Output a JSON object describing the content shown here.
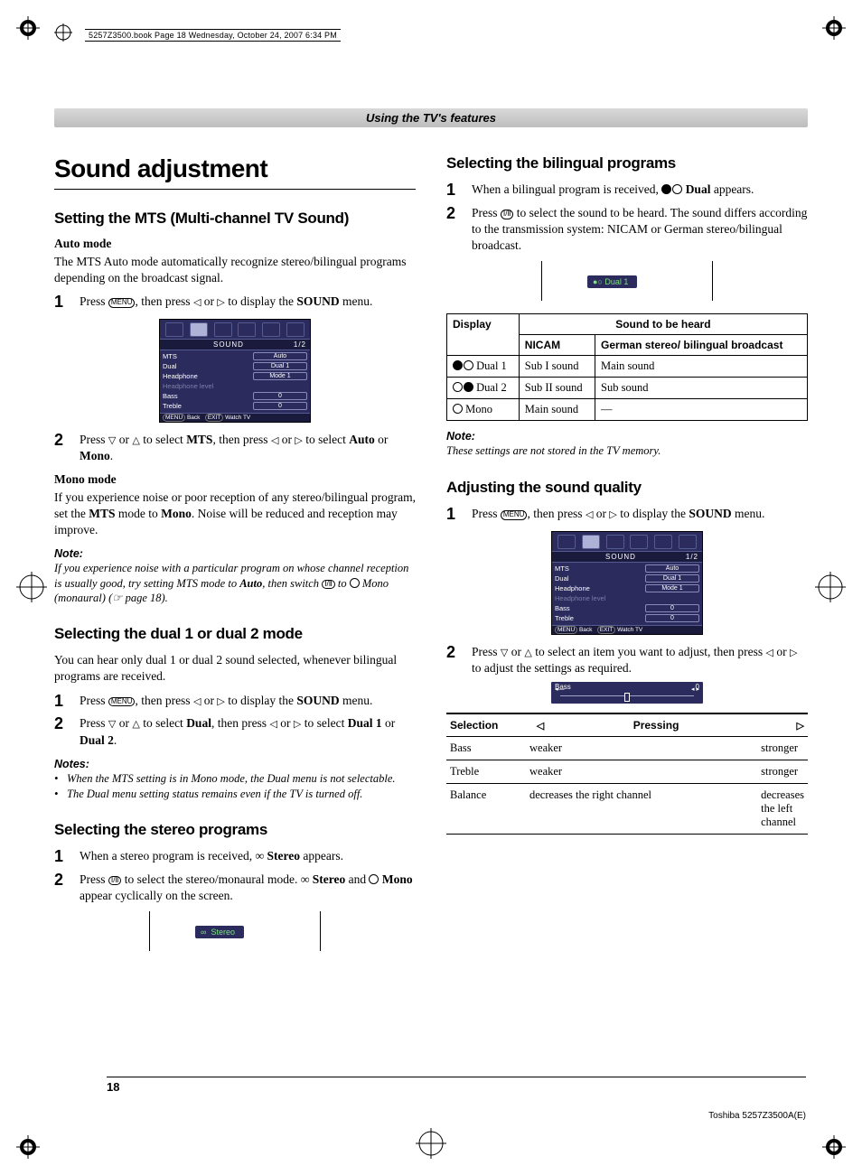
{
  "header_line": "5257Z3500.book  Page 18  Wednesday, October 24, 2007  6:34 PM",
  "section_bar": "Using the TV's features",
  "main_title": "Sound adjustment",
  "mts": {
    "heading": "Setting the MTS (Multi-channel TV Sound)",
    "auto_head": "Auto mode",
    "auto_body": "The MTS Auto mode automatically recognize stereo/bilingual programs depending on the broadcast signal.",
    "step1_a": "Press ",
    "step1_menu": "MENU",
    "step1_b": ", then press ",
    "step1_c": " or ",
    "step1_d": " to display the ",
    "step1_bold": "SOUND",
    "step1_e": " menu.",
    "step2_a": "Press ",
    "step2_b": " or ",
    "step2_c": " to select ",
    "step2_mts": "MTS",
    "step2_d": ", then press ",
    "step2_e": " or ",
    "step2_f": " to select ",
    "step2_auto": "Auto",
    "step2_g": " or ",
    "step2_mono": "Mono",
    "step2_h": ".",
    "mono_head": "Mono mode",
    "mono_body_a": "If you experience noise or poor reception of any stereo/bilingual program, set the ",
    "mono_body_mts": "MTS",
    "mono_body_b": " mode to ",
    "mono_body_mono": "Mono",
    "mono_body_c": ". Noise will be reduced and reception may improve.",
    "note_head": "Note:",
    "note_body_a": "If you experience noise with a particular program on whose channel reception is usually good, try setting MTS mode to ",
    "note_auto": "Auto",
    "note_body_b": ", then switch ",
    "note_btn": "Ⅰ/Ⅱ",
    "note_body_c": " to ",
    "note_body_d": " Mono (monaural) (",
    "note_page": " page 18)."
  },
  "dual": {
    "heading": "Selecting the dual 1 or dual 2 mode",
    "intro": "You can hear only dual 1 or dual 2 sound selected, whenever bilingual programs are received.",
    "step1_a": "Press ",
    "step1_b": ", then press ",
    "step1_c": " or ",
    "step1_d": " to display the ",
    "step1_bold": "SOUND",
    "step1_e": " menu.",
    "step2_a": "Press ",
    "step2_b": " or ",
    "step2_c": " to select ",
    "step2_dual": "Dual",
    "step2_d": ", then press ",
    "step2_e": " or ",
    "step2_f": " to select ",
    "step2_d1": "Dual 1",
    "step2_g": " or ",
    "step2_d2": "Dual 2",
    "step2_h": ".",
    "notes_head": "Notes:",
    "note1_a": "When the MTS setting is in ",
    "note1_mono": "Mono",
    "note1_b": " mode, the ",
    "note1_dual": "Dual",
    "note1_c": " menu is not selectable.",
    "note2_a": "The ",
    "note2_dual": "Dual",
    "note2_b": " menu setting status remains even if the TV is turned off."
  },
  "stereo": {
    "heading": "Selecting the stereo programs",
    "step1_a": "When a stereo program is received, ",
    "step1_b": " Stereo",
    "step1_c": " appears.",
    "step2_a": "Press ",
    "step2_btn": "Ⅰ/Ⅱ",
    "step2_b": " to select the stereo/monaural mode. ",
    "step2_stereo": " Stereo",
    "step2_c": " and ",
    "step2_mono": " Mono",
    "step2_d": " appear cyclically on the screen.",
    "osd": "Stereo"
  },
  "bilingual": {
    "heading": "Selecting the bilingual programs",
    "step1_a": "When a bilingual program is received, ",
    "step1_b": " Dual",
    "step1_c": " appears.",
    "step2_a": "Press ",
    "step2_btn": "Ⅰ/Ⅱ",
    "step2_b": " to select the sound to be heard. The sound differs according to the transmission system: NICAM or German stereo/bilingual broadcast.",
    "osd": "Dual  1",
    "table": {
      "h_display": "Display",
      "h_sound": "Sound to be heard",
      "h_nicam": "NICAM",
      "h_german": "German stereo/ bilingual broadcast",
      "r1_disp": " Dual 1",
      "r1_n": "Sub I sound",
      "r1_g": "Main sound",
      "r2_disp": " Dual 2",
      "r2_n": "Sub II sound",
      "r2_g": "Sub sound",
      "r3_disp": " Mono",
      "r3_n": "Main sound",
      "r3_g": "—"
    },
    "note_head": "Note:",
    "note_body": "These settings are not stored in the TV memory."
  },
  "quality": {
    "heading": "Adjusting the sound quality",
    "step1_a": "Press ",
    "step1_b": ", then press ",
    "step1_c": " or ",
    "step1_d": " to display the ",
    "step1_bold": "SOUND",
    "step1_e": " menu.",
    "step2_a": "Press ",
    "step2_b": " or ",
    "step2_c": " to select an item you want to adjust, then press ",
    "step2_d": " or ",
    "step2_e": " to adjust the settings as required.",
    "bass_label": "Bass",
    "bass_val": "0",
    "table": {
      "h_sel": "Selection",
      "h_press": "Pressing",
      "r1_s": "Bass",
      "r1_l": "weaker",
      "r1_r": "stronger",
      "r2_s": "Treble",
      "r2_l": "weaker",
      "r2_r": "stronger",
      "r3_s": "Balance",
      "r3_l": "decreases the right channel",
      "r3_r": "decreases the left channel"
    }
  },
  "sound_menu": {
    "title": "SOUND",
    "page": "1/2",
    "rows": [
      {
        "label": "MTS",
        "val": "Auto"
      },
      {
        "label": "Dual",
        "val": "Dual 1"
      },
      {
        "label": "Headphone",
        "val": "Mode 1"
      },
      {
        "label": "Headphone level",
        "val": ""
      },
      {
        "label": "Bass",
        "val": "0"
      },
      {
        "label": "Treble",
        "val": "0"
      }
    ],
    "foot_back": "Back",
    "foot_menu": "MENU",
    "foot_exit": "EXIT",
    "foot_watch": "Watch TV"
  },
  "page_number": "18",
  "footer_right": "Toshiba 5257Z3500A(E)"
}
